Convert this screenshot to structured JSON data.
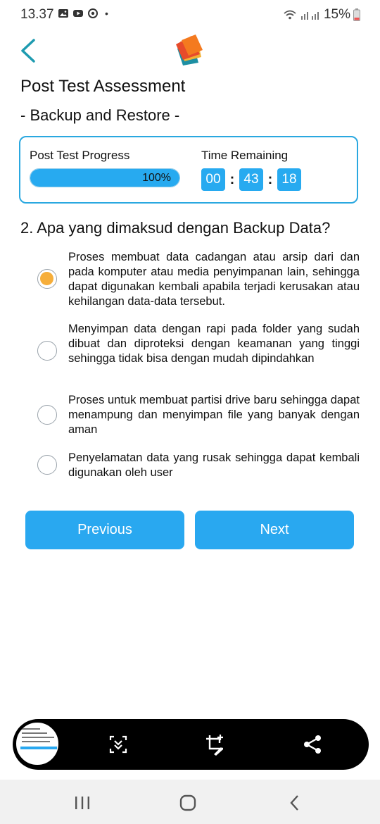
{
  "status_bar": {
    "time": "13.37",
    "dot": "•",
    "battery": "15%",
    "icons": [
      "gallery-icon",
      "youtube-icon",
      "sync-icon",
      "wifi-icon",
      "signal-icon",
      "battery-icon"
    ]
  },
  "header": {
    "title": "Post Test Assessment",
    "subtitle": "- Backup and Restore -"
  },
  "progress": {
    "label": "Post Test Progress",
    "percent_text": "100%",
    "fraction": 1.0
  },
  "timer": {
    "label": "Time Remaining",
    "hours": "00",
    "minutes": "43",
    "seconds": "18",
    "separator": ":"
  },
  "question": {
    "text": "2. Apa yang dimaksud dengan Backup Data?",
    "selected_index": 0,
    "options": [
      {
        "text": "Proses membuat data cadangan atau arsip dari dan pada komputer atau media penyimpanan lain, sehingga dapat digunakan kembali apabila terjadi kerusakan atau kehilangan data-data tersebut."
      },
      {
        "text": "Menyimpan data dengan rapi pada folder yang sudah dibuat dan diproteksi dengan keamanan yang tinggi sehingga tidak bisa dengan mudah dipindahkan"
      },
      {
        "text": "Proses untuk membuat partisi drive baru sehingga dapat menampung dan menyimpan file yang banyak dengan aman"
      },
      {
        "text": "Penyelamatan data yang rusak sehingga dapat kembali digunakan oleh user"
      }
    ]
  },
  "buttons": {
    "previous": "Previous",
    "next": "Next"
  },
  "colors": {
    "accent_blue": "#29a8f0",
    "selected_orange": "#f6ae3a",
    "back_teal": "#1e9bb0"
  }
}
